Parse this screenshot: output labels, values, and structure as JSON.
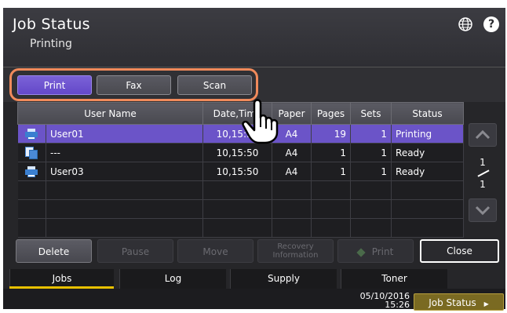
{
  "header": {
    "title": "Job Status",
    "subtitle": "Printing",
    "help_label": "?"
  },
  "filter_tabs": [
    {
      "label": "Print",
      "active": true
    },
    {
      "label": "Fax",
      "active": false
    },
    {
      "label": "Scan",
      "active": false
    }
  ],
  "table": {
    "columns": [
      "User Name",
      "Date,Time",
      "Paper",
      "Pages",
      "Sets",
      "Status"
    ],
    "rows": [
      {
        "icon": "printer-icon",
        "user": "User01",
        "datetime": "10,15:50",
        "paper": "A4",
        "pages": "19",
        "sets": "1",
        "status": "Printing",
        "selected": true
      },
      {
        "icon": "copy-icon",
        "user": "---",
        "datetime": "10,15:50",
        "paper": "A4",
        "pages": "1",
        "sets": "1",
        "status": "Ready",
        "selected": false
      },
      {
        "icon": "printer-icon",
        "user": "User03",
        "datetime": "10,15:50",
        "paper": "A4",
        "pages": "1",
        "sets": "1",
        "status": "Ready",
        "selected": false
      }
    ]
  },
  "pagination": {
    "current": "1",
    "total": "1"
  },
  "actions": {
    "delete": "Delete",
    "pause": "Pause",
    "move": "Move",
    "recovery_line1": "Recovery",
    "recovery_line2": "Information",
    "print": "Print",
    "close": "Close"
  },
  "bottom_tabs": [
    {
      "label": "Jobs",
      "active": true
    },
    {
      "label": "Log",
      "active": false
    },
    {
      "label": "Supply",
      "active": false
    },
    {
      "label": "Toner",
      "active": false
    }
  ],
  "status_bar": {
    "date": "05/10/2016",
    "time": "15:26",
    "job_status_button": "Job Status"
  },
  "colors": {
    "highlight": "#f08a5b",
    "selected_row": "#6b54c8",
    "active_tab_underline": "#e8c000",
    "job_status_button": "#7a6a22"
  }
}
